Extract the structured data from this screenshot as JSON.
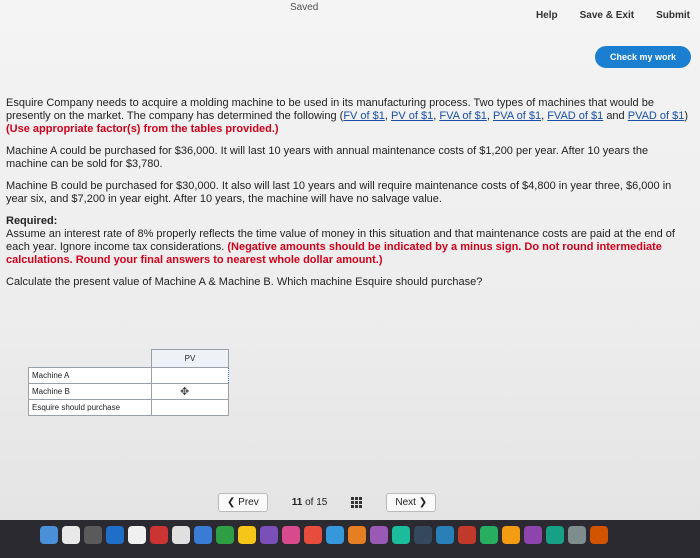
{
  "header": {
    "saved_status": "Saved",
    "help": "Help",
    "save_exit": "Save & Exit",
    "submit": "Submit",
    "check_work": "Check my work"
  },
  "problem": {
    "intro": "Esquire Company needs to acquire a molding machine to be used in its manufacturing process. Two types of machines that would be presently on the market. The company has determined the following (",
    "links": [
      "FV of $1",
      "PV of $1",
      "FVA of $1",
      "PVA of $1",
      "FVAD of $1",
      "PVAD of $1"
    ],
    "intro_and": "and",
    "intro_close": ")",
    "factor_note": "(Use appropriate factor(s) from the tables provided.)",
    "machine_a": "Machine A could be purchased for $36,000. It will last 10 years with annual maintenance costs of $1,200 per year. After 10 years the machine can be sold for $3,780.",
    "machine_b": "Machine B could be purchased for $30,000. It also will last 10 years and will require maintenance costs of $4,800 in year three, $6,000 in year six, and $7,200 in year eight. After 10 years, the machine will have no salvage value.",
    "required_label": "Required:",
    "required_text": "Assume an interest rate of 8% properly reflects the time value of money in this situation and that maintenance costs are paid at the end of each year. Ignore income tax considerations.",
    "required_red": "(Negative amounts should be indicated by a minus sign. Do not round intermediate calculations. Round your final answers to nearest whole dollar amount.)",
    "question": "Calculate the present value of Machine A & Machine B. Which machine Esquire should purchase?"
  },
  "answer_table": {
    "header": "PV",
    "rows": [
      {
        "label": "Machine A",
        "value": ""
      },
      {
        "label": "Machine B",
        "value": ""
      },
      {
        "label": "Esquire should purchase",
        "value": ""
      }
    ]
  },
  "navigation": {
    "prev": "Prev",
    "page_current": "11",
    "page_of": "of",
    "page_total": "15",
    "next": "Next"
  }
}
